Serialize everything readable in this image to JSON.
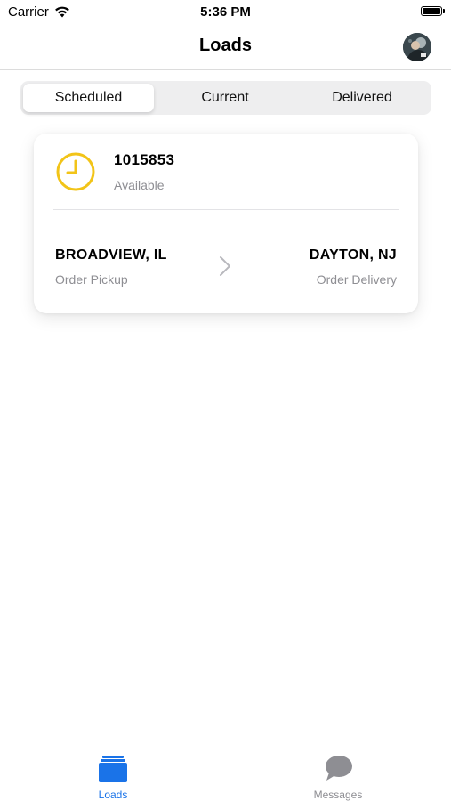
{
  "status_bar": {
    "carrier": "Carrier",
    "time": "5:36 PM"
  },
  "nav": {
    "title": "Loads"
  },
  "segments": [
    {
      "label": "Scheduled",
      "selected": true
    },
    {
      "label": "Current",
      "selected": false
    },
    {
      "label": "Delivered",
      "selected": false
    }
  ],
  "load": {
    "id": "1015853",
    "status": "Available",
    "origin_city": "BROADVIEW, IL",
    "origin_label": "Order Pickup",
    "destination_city": "DAYTON, NJ",
    "destination_label": "Order Delivery"
  },
  "tab_bar": {
    "tabs": [
      {
        "label": "Loads",
        "icon": "stacked-layers-icon",
        "active": true
      },
      {
        "label": "Messages",
        "icon": "speech-bubble-icon",
        "active": false
      }
    ]
  },
  "colors": {
    "accent": "#1a73e8",
    "clock": "#f2c418",
    "secondary_text": "#8e8e93"
  }
}
